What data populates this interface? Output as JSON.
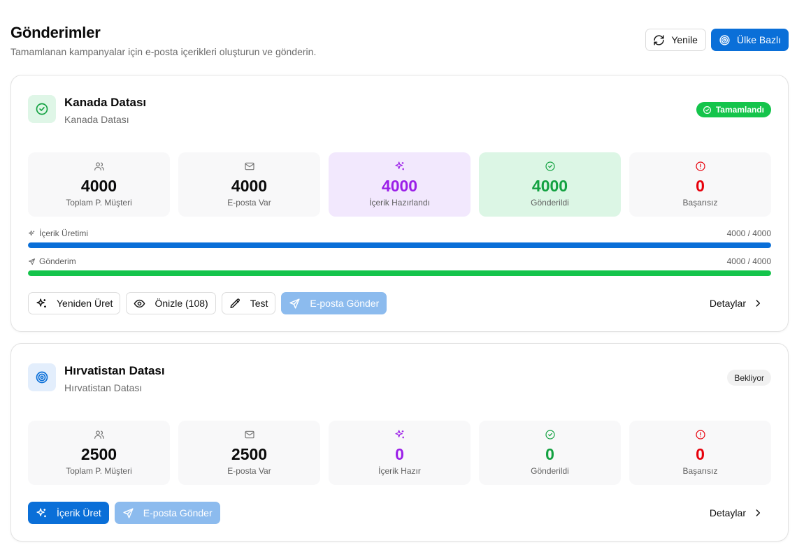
{
  "header": {
    "title": "Gönderimler",
    "subtitle": "Tamamlanan kampanyalar için e-posta içerikleri oluşturun ve gönderin.",
    "refresh_label": "Yenile",
    "country_label": "Ülke Bazlı"
  },
  "campaigns": [
    {
      "title": "Kanada Datası",
      "subtitle": "Kanada Datası",
      "status": "Tamamlandı",
      "stats": [
        {
          "value": "4000",
          "label": "Toplam P. Müşteri"
        },
        {
          "value": "4000",
          "label": "E-posta Var"
        },
        {
          "value": "4000",
          "label": "İçerik Hazırlandı"
        },
        {
          "value": "4000",
          "label": "Gönderildi"
        },
        {
          "value": "0",
          "label": "Başarısız"
        }
      ],
      "progress": [
        {
          "label": "İçerik Üretimi",
          "count": "4000 / 4000",
          "fraction": 1.0
        },
        {
          "label": "Gönderim",
          "count": "4000 / 4000",
          "fraction": 1.0
        }
      ],
      "actions": {
        "regenerate": "Yeniden Üret",
        "preview": "Önizle (108)",
        "test": "Test",
        "send": "E-posta Gönder"
      },
      "details_label": "Detaylar"
    },
    {
      "title": "Hırvatistan Datası",
      "subtitle": "Hırvatistan Datası",
      "status": "Bekliyor",
      "stats": [
        {
          "value": "2500",
          "label": "Toplam P. Müşteri"
        },
        {
          "value": "2500",
          "label": "E-posta Var"
        },
        {
          "value": "0",
          "label": "İçerik Hazır"
        },
        {
          "value": "0",
          "label": "Gönderildi"
        },
        {
          "value": "0",
          "label": "Başarısız"
        }
      ],
      "actions": {
        "generate": "İçerik Üret",
        "send": "E-posta Gönder"
      },
      "details_label": "Detaylar"
    }
  ],
  "colors": {
    "primary": "#0a6fd8",
    "success": "#14c44b",
    "purple": "#9b1fe8",
    "danger": "#e7000b"
  }
}
